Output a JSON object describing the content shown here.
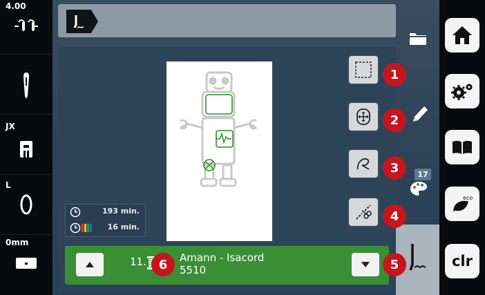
{
  "left_sidebar": {
    "stitch_width": "4.00",
    "presser_foot": "JX",
    "stitch_plate": "L",
    "offset": "0mm"
  },
  "timing": {
    "total_time": "193 min.",
    "remaining_time": "16 min."
  },
  "thread": {
    "number": "11.",
    "brand": "Amann - Isacord",
    "code": "5510"
  },
  "callouts": [
    "1",
    "2",
    "3",
    "4",
    "5",
    "6"
  ],
  "colors_badge": "17",
  "right_sidebar": {
    "clr_label": "clr"
  },
  "icons": [
    "needle-icon",
    "stitch-width-icon",
    "presser-foot-icon",
    "stitch-plate-icon",
    "home-icon",
    "settings-icon",
    "tutorial-icon",
    "eco-icon",
    "folder-icon",
    "pencil-icon",
    "palette-icon",
    "embroidery-mode-icon",
    "layout-icon",
    "move-icon",
    "check-icon",
    "cut-icon",
    "colors-icon",
    "spool-icon",
    "clock-icon"
  ],
  "accent_colors": {
    "green": "#3a8f35",
    "red": "#c8141c",
    "panel": "#2d4358"
  }
}
